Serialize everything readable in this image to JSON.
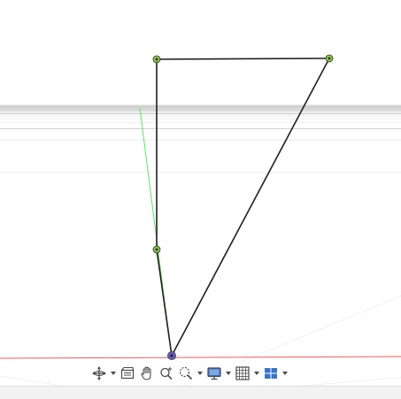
{
  "colors": {
    "grid_minor": "#dcdcdc",
    "grid_major": "#c4c4c4",
    "x_axis": "#ef5a5a",
    "y_axis": "#5ee35e",
    "sketch_line": "#1f1f1f",
    "point_fill": "#8bc34a",
    "origin_point": "#6a5acd",
    "toolbar_icon": "#4a4a4a",
    "toolbar_accent": "#3b74c9"
  },
  "toolbar": {
    "orbit": {
      "icon": "orbit-icon"
    },
    "look_at": {
      "icon": "look-at-icon"
    },
    "pan": {
      "icon": "hand-pan-icon"
    },
    "zoom": {
      "icon": "zoom-icon"
    },
    "fit": {
      "icon": "zoom-window-icon"
    },
    "display_settings": {
      "icon": "display-settings-icon"
    },
    "grid_snaps": {
      "icon": "grid-icon"
    },
    "viewports": {
      "icon": "viewports-icon"
    }
  }
}
